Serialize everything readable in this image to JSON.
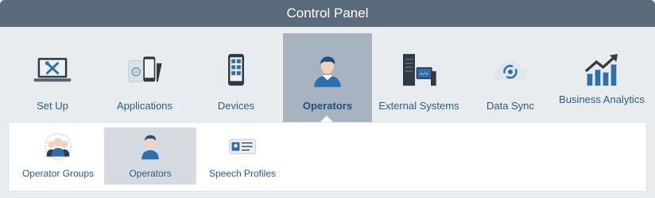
{
  "title": "Control Panel",
  "tabs": [
    {
      "label": "Set Up",
      "icon": "laptop-tools-icon"
    },
    {
      "label": "Applications",
      "icon": "phone-app-icon"
    },
    {
      "label": "Devices",
      "icon": "mobile-device-icon"
    },
    {
      "label": "Operators",
      "icon": "operator-icon",
      "active": true
    },
    {
      "label": "External Systems",
      "icon": "server-icon"
    },
    {
      "label": "Data Sync",
      "icon": "cloud-sync-icon"
    },
    {
      "label": "Business Analytics",
      "icon": "chart-up-icon"
    }
  ],
  "subtabs": [
    {
      "label": "Operator Groups",
      "icon": "operator-group-icon"
    },
    {
      "label": "Operators",
      "icon": "operator-icon",
      "active": true
    },
    {
      "label": "Speech Profiles",
      "icon": "id-card-icon"
    }
  ],
  "colors": {
    "header": "#5a6a7a",
    "active_tab": "#a6b3bf",
    "active_subtab": "#d5dbe0",
    "link": "#2a5d8f"
  }
}
